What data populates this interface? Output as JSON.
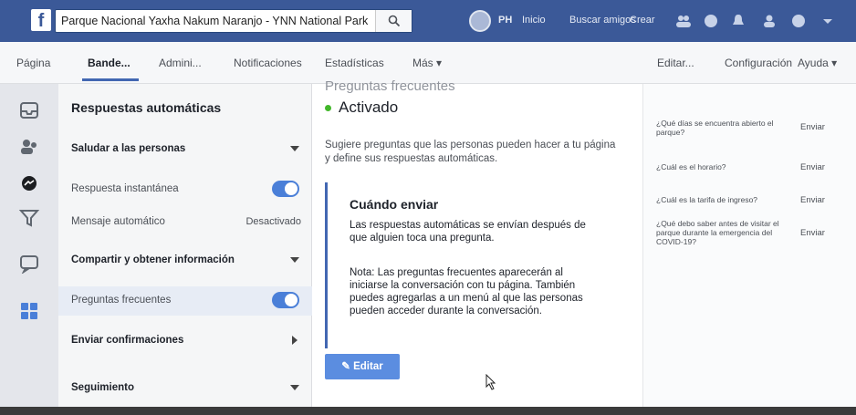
{
  "topbar": {
    "logo": "f",
    "search_value": "Parque Nacional Yaxha Nakum Naranjo - YNN National Park",
    "user_initials": "PH",
    "nav": [
      "Inicio",
      "Buscar amigos",
      "Crear"
    ]
  },
  "tabs": {
    "items": [
      "Página",
      "Bande...",
      "Admini...",
      "Notificaciones",
      "Estadísticas",
      "Más ▾"
    ],
    "active": "Bande...",
    "right": [
      "Editar...",
      "Configuración",
      "Ayuda ▾"
    ]
  },
  "menu": {
    "title": "Respuestas automáticas",
    "rows": [
      {
        "label": "Saludar a las personas",
        "control": "chevron-down"
      },
      {
        "label": "Respuesta instantánea",
        "control": "toggle-on"
      },
      {
        "label": "Mensaje automático",
        "status": "Desactivado"
      },
      {
        "label": "Compartir y obtener información",
        "control": "chevron-down"
      },
      {
        "label": "Preguntas frecuentes",
        "control": "toggle-on"
      },
      {
        "label": "Enviar confirmaciones",
        "control": "chevron-right"
      },
      {
        "label": "Seguimiento",
        "control": "chevron-down"
      }
    ]
  },
  "content": {
    "cut_heading": "Preguntas frecuentes",
    "status": "Activado",
    "description": "Sugiere preguntas que las personas pueden hacer a tu página y define sus respuestas automáticas.",
    "when_title": "Cuándo enviar",
    "when_text": "Las respuestas automáticas se envían después de que alguien toca una pregunta.",
    "when_note": "Nota: Las preguntas frecuentes aparecerán al iniciarse la conversación con tu página. También puedes agregarlas a un menú al que las personas pueden acceder durante la conversación.",
    "edit_label": "✎ Editar"
  },
  "questions": [
    {
      "text": "¿Qué días se encuentra abierto el parque?",
      "send": "Enviar"
    },
    {
      "text": "¿Cuál es el horario?",
      "send": "Enviar"
    },
    {
      "text": "¿Cuál es la tarifa de ingreso?",
      "send": "Enviar"
    },
    {
      "text": "¿Qué debo saber antes de visitar el parque durante la emergencia del COVID-19?",
      "send": "Enviar"
    }
  ],
  "colors": {
    "fb_blue": "#3b5998",
    "accent": "#4267b2",
    "toggle": "#4a7fd8",
    "active_dot": "#42b72a"
  }
}
